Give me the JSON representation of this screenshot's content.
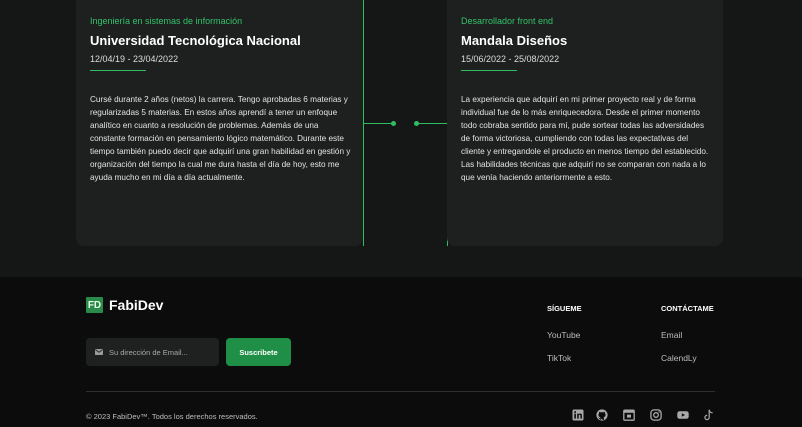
{
  "timeline": {
    "left": {
      "tag": "Ingeniería en sistemas de información",
      "title": "Universidad Tecnológica Nacional",
      "date": "12/04/19 - 23/04/2022",
      "body": "Cursé durante 2 años (netos) la carrera. Tengo aprobadas 6 materias y regularizadas 5 materias. En estos años aprendí a tener un enfoque analítico en cuanto a resolución de problemas. Además de una constante formación en pensamiento lógico matemático. Durante este tiempo también puedo decir que adquirí una gran habilidad en gestión y organización del tiempo la cual me dura hasta el día de hoy, esto me ayuda mucho en mi día a día actualmente."
    },
    "right": {
      "tag": "Desarrollador front end",
      "title": "Mandala Diseños",
      "date": "15/06/2022 - 25/08/2022",
      "body": "La experiencia que adquirí en mi primer proyecto real y de forma individual fue de lo más enriquecedora. Desde el primer momento todo cobraba sentido para mí, pude sortear todas las adversidades de forma victoriosa, cumpliendo con todas las expectativas del cliente y entregandole el producto en menos tiempo del establecido. Las habilidades técnicas que adquirí no se comparan con nada a lo que venía haciendo anteriormente a esto."
    }
  },
  "footer": {
    "logo_mark": "FD",
    "brand": "FabiDev",
    "email_placeholder": "Su dirección de Email...",
    "subscribe_label": "Suscribete",
    "follow": {
      "heading": "SÍGUEME",
      "links": [
        "YouTube",
        "TikTok"
      ]
    },
    "contact": {
      "heading": "CONTÁCTAME",
      "links": [
        "Email",
        "CalendLy"
      ]
    },
    "copyright": "© 2023 FabiDev™. Todos los derechos reservados.",
    "social_icons": [
      "linkedin-icon",
      "github-icon",
      "calendar-icon",
      "instagram-icon",
      "youtube-icon",
      "tiktok-icon"
    ]
  },
  "colors": {
    "accent": "#2fbd62",
    "button": "#1f8f47",
    "card": "#1d201f",
    "footer": "#0c0c0c",
    "background": "#151716"
  }
}
